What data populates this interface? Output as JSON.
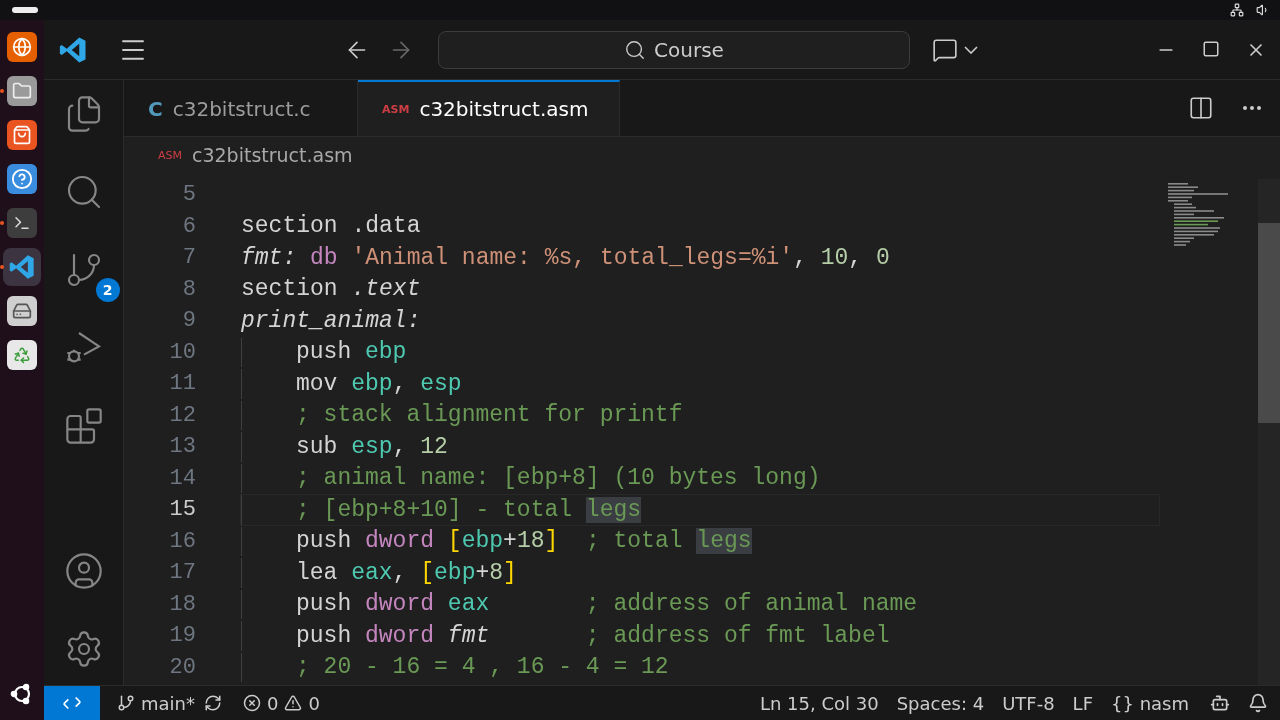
{
  "dock": {
    "apps": [
      {
        "kind": "browser",
        "running": false,
        "selected": false
      },
      {
        "kind": "files",
        "running": true,
        "selected": false
      },
      {
        "kind": "store",
        "running": false,
        "selected": false
      },
      {
        "kind": "help",
        "running": false,
        "selected": false
      },
      {
        "kind": "terminal",
        "running": true,
        "selected": false
      },
      {
        "kind": "editor",
        "running": true,
        "selected": true
      },
      {
        "kind": "drive",
        "running": false,
        "selected": false
      },
      {
        "kind": "trash",
        "running": false,
        "selected": false
      }
    ]
  },
  "title_bar": {
    "back": {
      "disabled": false
    },
    "forward": {
      "disabled": true
    },
    "search": "Course"
  },
  "tabs": [
    {
      "icon": "C",
      "color": "#519aba",
      "label": "c32bitstruct.c",
      "selected": false
    },
    {
      "icon": "ASM",
      "color": "#cc3e44",
      "label": "c32bitstruct.asm",
      "selected": true
    }
  ],
  "breadcrumb": {
    "icon": "ASM",
    "label": "c32bitstruct.asm"
  },
  "activity_bar": {
    "top": [
      {
        "kind": "explorer"
      },
      {
        "kind": "search"
      },
      {
        "kind": "source-control",
        "badge": "2"
      },
      {
        "kind": "run-debug"
      },
      {
        "kind": "extensions"
      }
    ],
    "bottom": [
      {
        "kind": "account"
      },
      {
        "kind": "settings"
      }
    ]
  },
  "editor": {
    "lines": [
      {
        "number": "5",
        "current": false,
        "indented": false
      },
      {
        "number": "6",
        "current": false,
        "indented": false,
        "tokens": [
          {
            "kind": "plain",
            "text": "section .data"
          }
        ]
      },
      {
        "number": "7",
        "current": false,
        "indented": false,
        "tokens": [
          {
            "kind": "label",
            "text": "fmt:"
          },
          {
            "kind": "keyword",
            "text": " db"
          },
          {
            "kind": "string",
            "text": " 'Animal name: %s, total_legs=%i'"
          },
          {
            "kind": "plain",
            "text": ", "
          },
          {
            "kind": "number",
            "text": "10"
          },
          {
            "kind": "plain",
            "text": ", "
          },
          {
            "kind": "number",
            "text": "0"
          }
        ]
      },
      {
        "number": "8",
        "current": false,
        "indented": false,
        "tokens": [
          {
            "kind": "plain",
            "text": "section "
          },
          {
            "kind": "label",
            "text": ".text"
          }
        ]
      },
      {
        "number": "9",
        "current": false,
        "indented": false,
        "tokens": [
          {
            "kind": "label",
            "text": "print_animal:"
          }
        ]
      },
      {
        "number": "10",
        "current": false,
        "indented": true,
        "tokens": [
          {
            "kind": "plain",
            "text": "push "
          },
          {
            "kind": "register",
            "text": "ebp"
          }
        ]
      },
      {
        "number": "11",
        "current": false,
        "indented": true,
        "tokens": [
          {
            "kind": "plain",
            "text": "mov "
          },
          {
            "kind": "register",
            "text": "ebp"
          },
          {
            "kind": "plain",
            "text": ", "
          },
          {
            "kind": "register",
            "text": "esp"
          }
        ]
      },
      {
        "number": "12",
        "current": false,
        "indented": true,
        "tokens": [
          {
            "kind": "comment",
            "text": "; stack alignment for printf"
          }
        ]
      },
      {
        "number": "13",
        "current": false,
        "indented": true,
        "tokens": [
          {
            "kind": "plain",
            "text": "sub "
          },
          {
            "kind": "register",
            "text": "esp"
          },
          {
            "kind": "plain",
            "text": ", "
          },
          {
            "kind": "number",
            "text": "12"
          }
        ]
      },
      {
        "number": "14",
        "current": false,
        "indented": true,
        "tokens": [
          {
            "kind": "comment",
            "text": "; animal name: [ebp+8] (10 bytes long)"
          }
        ]
      },
      {
        "number": "15",
        "current": true,
        "indented": true,
        "tokens": [
          {
            "kind": "comment",
            "text": "; [ebp+8+10] - total "
          },
          {
            "kind": "comment-match",
            "text": "legs"
          }
        ]
      },
      {
        "number": "16",
        "current": false,
        "indented": true,
        "tokens": [
          {
            "kind": "plain",
            "text": "push "
          },
          {
            "kind": "keyword",
            "text": "dword"
          },
          {
            "kind": "bracket",
            "text": " ["
          },
          {
            "kind": "register",
            "text": "ebp"
          },
          {
            "kind": "plain",
            "text": "+"
          },
          {
            "kind": "number",
            "text": "18"
          },
          {
            "kind": "bracket",
            "text": "]"
          },
          {
            "kind": "comment",
            "text": "  ; total "
          },
          {
            "kind": "comment-match",
            "text": "legs"
          }
        ]
      },
      {
        "number": "17",
        "current": false,
        "indented": true,
        "tokens": [
          {
            "kind": "plain",
            "text": "lea "
          },
          {
            "kind": "register",
            "text": "eax"
          },
          {
            "kind": "plain",
            "text": ", "
          },
          {
            "kind": "bracket",
            "text": "["
          },
          {
            "kind": "register",
            "text": "ebp"
          },
          {
            "kind": "plain",
            "text": "+"
          },
          {
            "kind": "number",
            "text": "8"
          },
          {
            "kind": "bracket",
            "text": "]"
          }
        ]
      },
      {
        "number": "18",
        "current": false,
        "indented": true,
        "tokens": [
          {
            "kind": "plain",
            "text": "push "
          },
          {
            "kind": "keyword",
            "text": "dword"
          },
          {
            "kind": "register",
            "text": " eax"
          },
          {
            "kind": "comment",
            "text": "       ; address of animal name"
          }
        ]
      },
      {
        "number": "19",
        "current": false,
        "indented": true,
        "tokens": [
          {
            "kind": "plain",
            "text": "push "
          },
          {
            "kind": "keyword",
            "text": "dword"
          },
          {
            "kind": "label",
            "text": " fmt"
          },
          {
            "kind": "comment",
            "text": "       ; address of fmt label"
          }
        ]
      },
      {
        "number": "20",
        "current": false,
        "indented": true,
        "tokens": [
          {
            "kind": "comment",
            "text": "; 20 - 16 = 4 , 16 - 4 = 12"
          }
        ]
      }
    ]
  },
  "status_bar": {
    "branch": "main*",
    "errors": "0",
    "warnings": "0",
    "right": [
      {
        "kind": "text",
        "label": "Ln 15, Col 30"
      },
      {
        "kind": "text",
        "label": "Spaces: 4"
      },
      {
        "kind": "text",
        "label": "UTF-8"
      },
      {
        "kind": "text",
        "label": "LF"
      },
      {
        "kind": "language",
        "icon": "{}",
        "label": "nasm"
      }
    ]
  }
}
